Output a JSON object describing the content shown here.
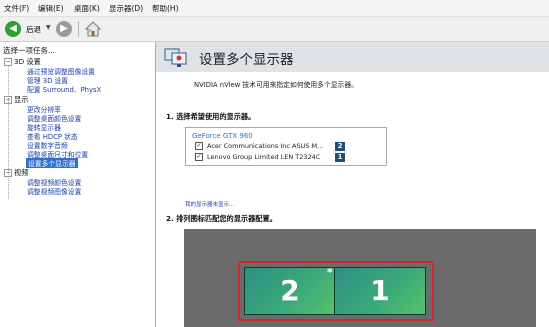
{
  "menu": [
    "文件(F)",
    "编辑(E)",
    "桌面(K)",
    "显示器(D)",
    "帮助(H)"
  ],
  "toolbar": {
    "back_label": "后退"
  },
  "left": {
    "title": "选择一项任务...",
    "categories": [
      {
        "label": "3D 设置",
        "links": [
          "通过预览调整图像设置",
          "管理 3D 设置",
          "配置 Surround、PhysX"
        ]
      },
      {
        "label": "显示",
        "links": [
          "更改分辨率",
          "调整桌面颜色设置",
          "旋转显示器",
          "查看 HDCP 状态",
          "设置数字音频",
          "调整桌面尺寸和位置",
          "设置多个显示器"
        ]
      },
      {
        "label": "视频",
        "links": [
          "调整视频颜色设置",
          "调整视频图像设置"
        ]
      }
    ]
  },
  "main": {
    "title": "设置多个显示器",
    "description": "NVIDIA nView 技术可用来指定如何使用多个显示器。",
    "section1": "1.  选择希望使用的显示器。",
    "gpu": "GeForce GTX 960",
    "monitors": [
      {
        "name": "Acer Communications Inc ASUS M...",
        "num": "2",
        "checked": true
      },
      {
        "name": "Lenovo Group Limited LEN T2324C",
        "num": "1",
        "checked": true
      }
    ],
    "small_link": "我的显示器未显示...",
    "section2": "2.  排列图标匹配您的显示器配置。",
    "displays": [
      {
        "num": "2",
        "primary": true
      },
      {
        "num": "1",
        "primary": false
      }
    ],
    "primary_mark": "*"
  }
}
